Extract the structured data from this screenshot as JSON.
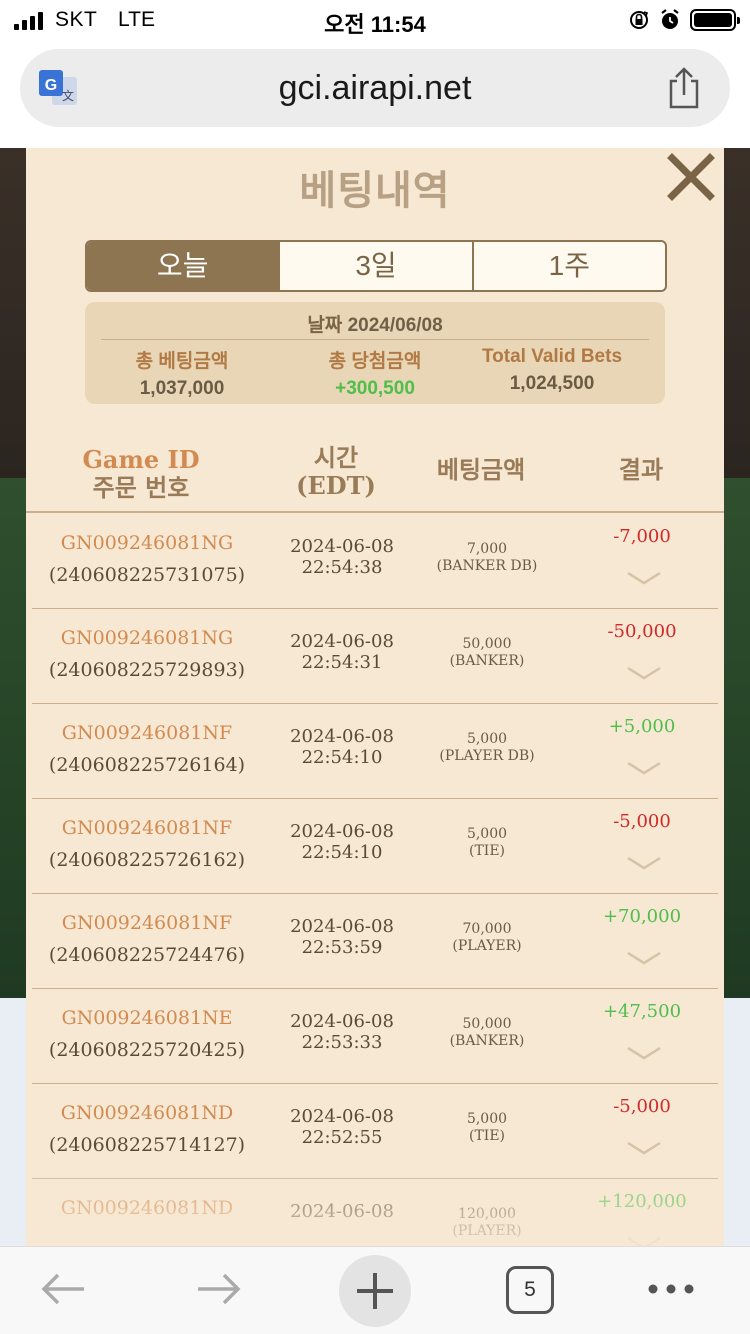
{
  "status_bar": {
    "carrier": "SKT",
    "network": "LTE",
    "time": "오전 11:54"
  },
  "browser": {
    "url": "gci.airapi.net",
    "tab_count": "5"
  },
  "modal": {
    "title": "베팅내역",
    "tabs": [
      "오늘",
      "3일",
      "1주"
    ],
    "active_tab": 0,
    "summary": {
      "date_label": "날짜",
      "date_value": "2024/06/08",
      "total_bet_label": "총 베팅금액",
      "total_bet_value": "1,037,000",
      "total_win_label": "총 당첨금액",
      "total_win_value": "+300,500",
      "valid_bets_label": "Total Valid Bets",
      "valid_bets_value": "1,024,500"
    },
    "columns": {
      "game_id": "Game ID",
      "order_no": "주문 번호",
      "time": "시간",
      "time_zone": "(EDT)",
      "bet_amount": "베팅금액",
      "result": "결과"
    },
    "rows": [
      {
        "game_id": "GN009246081NG",
        "order_no": "(240608225731075)",
        "date": "2024-06-08",
        "time": "22:54:38",
        "amount": "7,000",
        "bet_type": "(BANKER DB)",
        "result": "-7,000"
      },
      {
        "game_id": "GN009246081NG",
        "order_no": "(240608225729893)",
        "date": "2024-06-08",
        "time": "22:54:31",
        "amount": "50,000",
        "bet_type": "(BANKER)",
        "result": "-50,000"
      },
      {
        "game_id": "GN009246081NF",
        "order_no": "(240608225726164)",
        "date": "2024-06-08",
        "time": "22:54:10",
        "amount": "5,000",
        "bet_type": "(PLAYER DB)",
        "result": "+5,000"
      },
      {
        "game_id": "GN009246081NF",
        "order_no": "(240608225726162)",
        "date": "2024-06-08",
        "time": "22:54:10",
        "amount": "5,000",
        "bet_type": "(TIE)",
        "result": "-5,000"
      },
      {
        "game_id": "GN009246081NF",
        "order_no": "(240608225724476)",
        "date": "2024-06-08",
        "time": "22:53:59",
        "amount": "70,000",
        "bet_type": "(PLAYER)",
        "result": "+70,000"
      },
      {
        "game_id": "GN009246081NE",
        "order_no": "(240608225720425)",
        "date": "2024-06-08",
        "time": "22:53:33",
        "amount": "50,000",
        "bet_type": "(BANKER)",
        "result": "+47,500"
      },
      {
        "game_id": "GN009246081ND",
        "order_no": "(240608225714127)",
        "date": "2024-06-08",
        "time": "22:52:55",
        "amount": "5,000",
        "bet_type": "(TIE)",
        "result": "-5,000"
      },
      {
        "game_id": "GN009246081ND",
        "order_no": "",
        "date": "2024-06-08",
        "time": "",
        "amount": "120,000",
        "bet_type": "(PLAYER)",
        "result": "+120,000"
      }
    ]
  },
  "colors": {
    "accent": "#8d7552",
    "panel": "#f6e8d3",
    "game_id": "#d38a50",
    "negative": "#d02a2a",
    "positive": "#4fbe4b"
  },
  "icons": {
    "translate": "translate-icon",
    "share": "share-icon",
    "close": "close-icon",
    "expand": "chevron-down-icon",
    "back": "arrow-left-icon",
    "forward": "arrow-right-icon",
    "new_tab": "plus-icon",
    "more": "more-dots-icon"
  }
}
